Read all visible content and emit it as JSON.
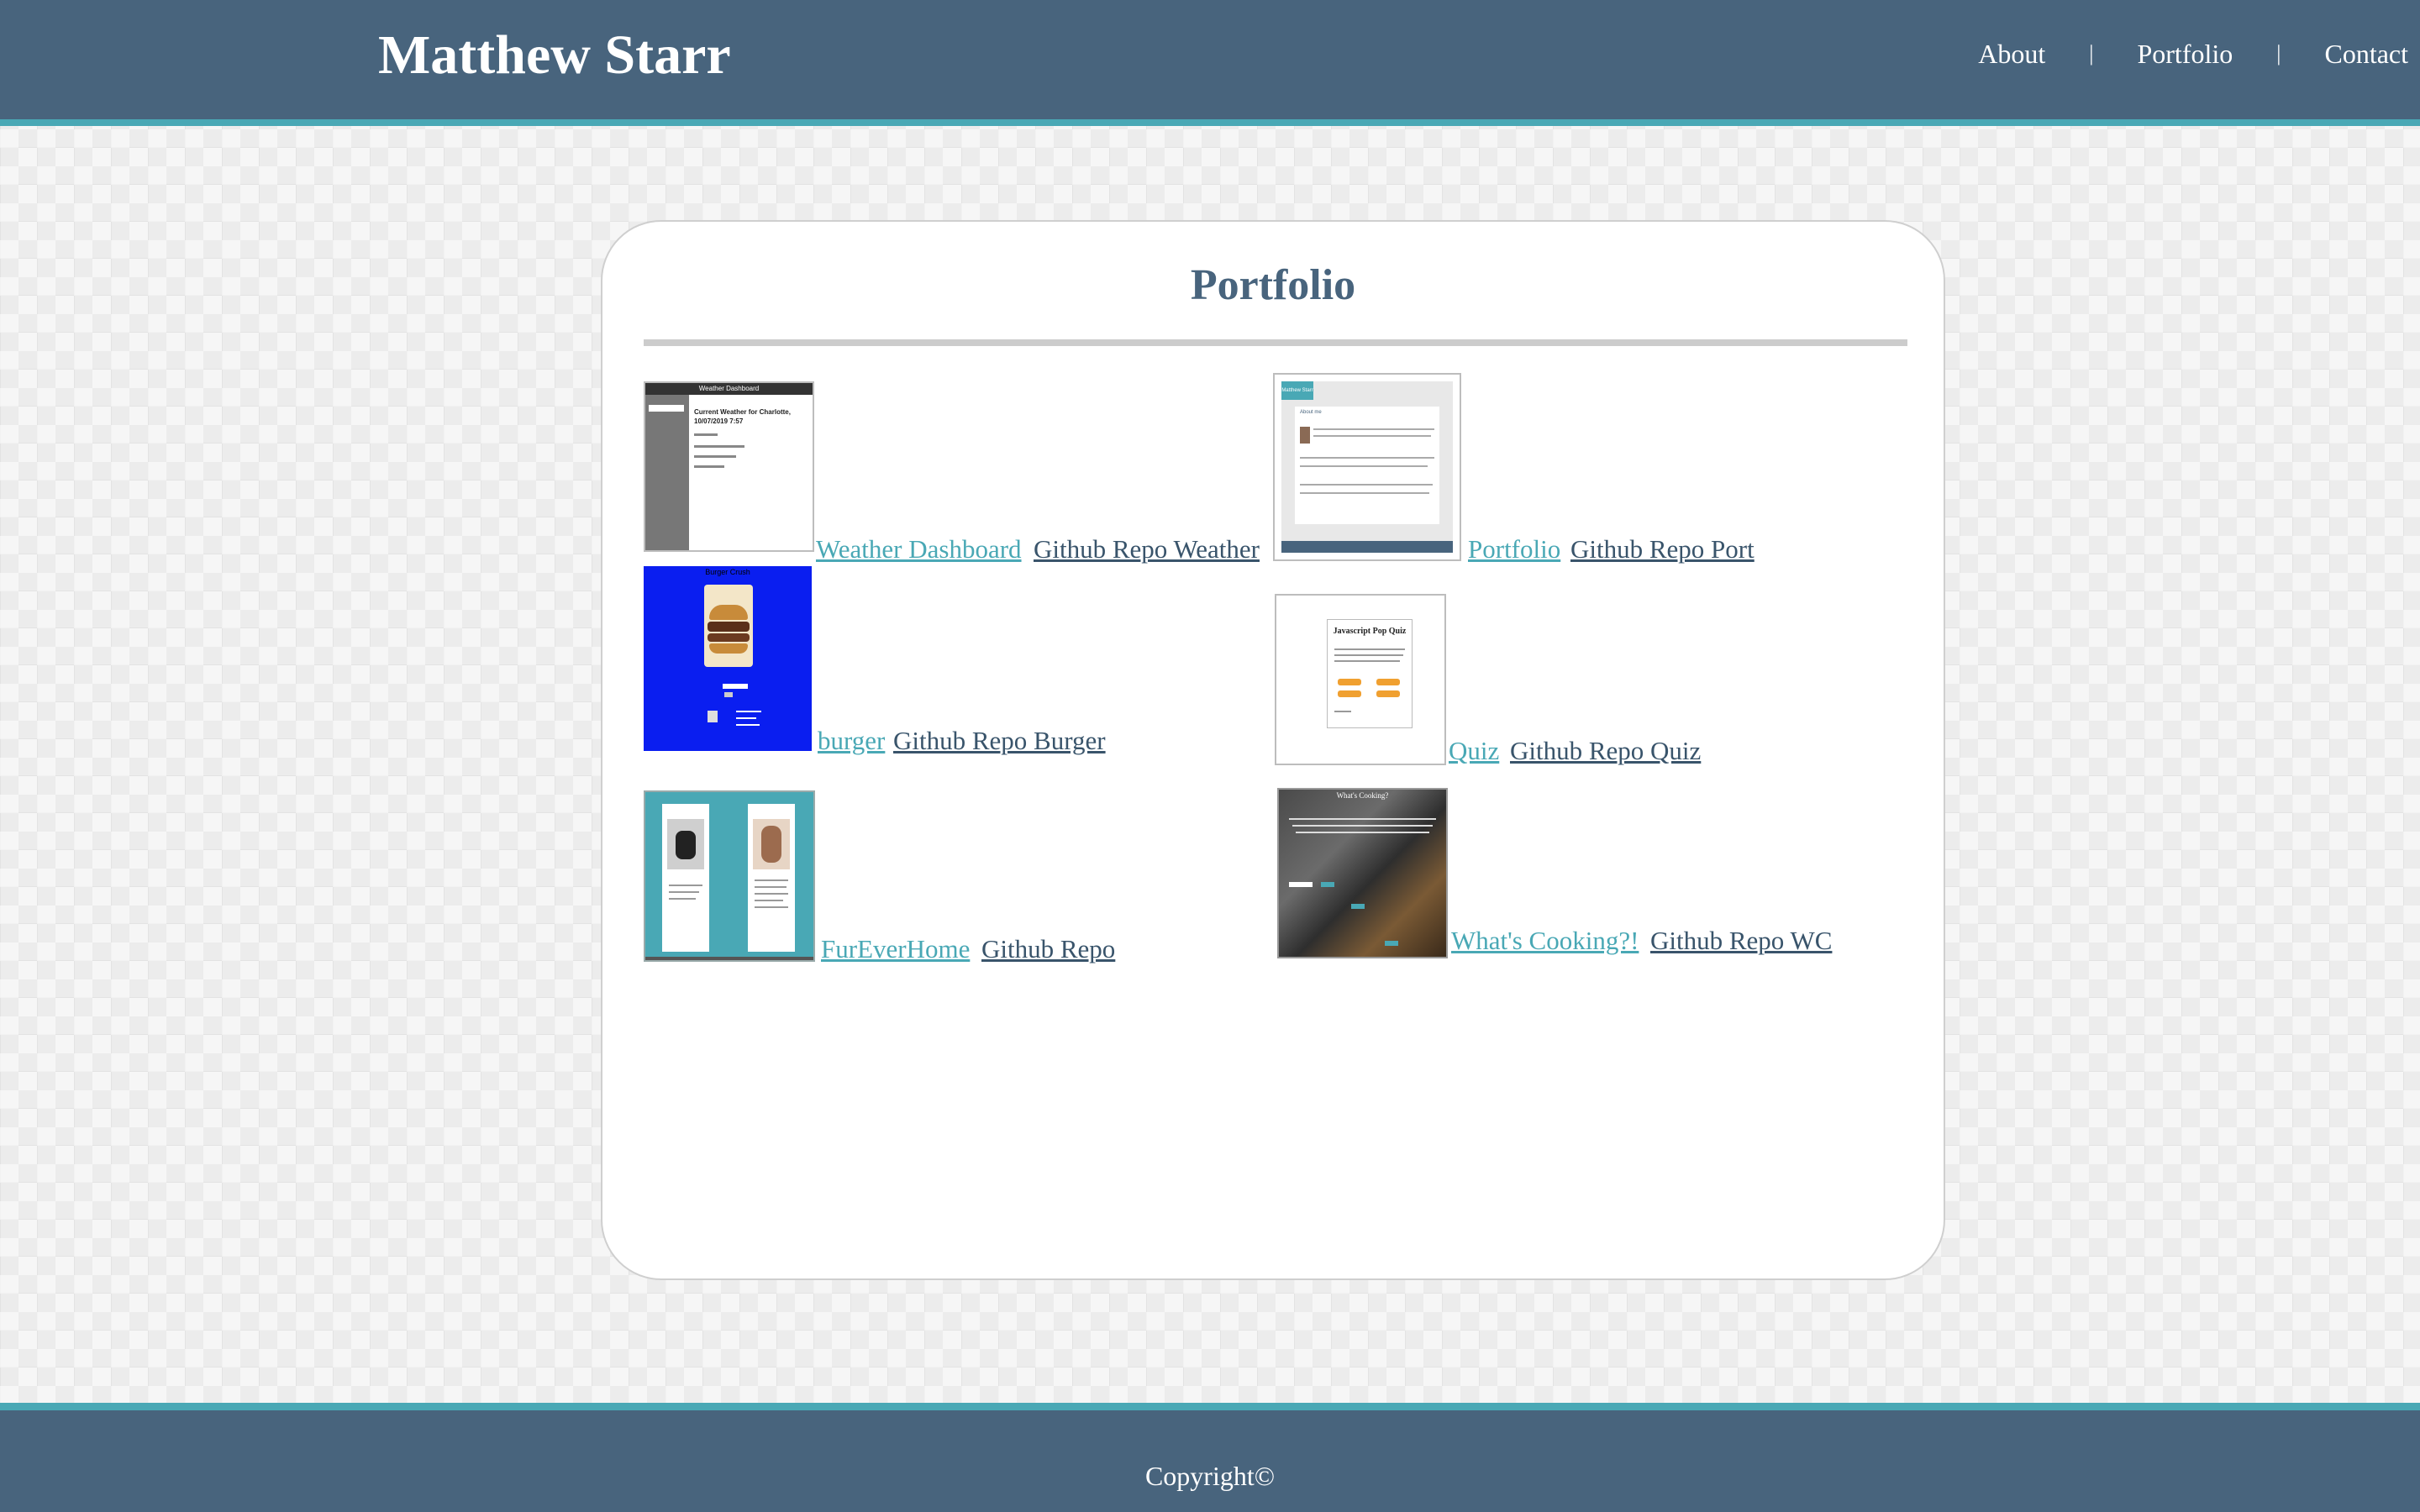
{
  "header": {
    "site_title": "Matthew Starr",
    "nav": [
      "About",
      "Portfolio",
      "Contact"
    ],
    "nav_separator": "|"
  },
  "main": {
    "title": "Portfolio",
    "projects": [
      {
        "demo_label": "Weather Dashboard",
        "repo_label": "Github Repo Weather",
        "thumb": {
          "header": "Weather Dashboard",
          "line1": "Current Weather for Charlotte,",
          "line2": "10/07/2019 7:57"
        }
      },
      {
        "demo_label": "Portfolio",
        "repo_label": "Github Repo Port",
        "thumb": {
          "brand": "Matthew Starr",
          "section": "About me"
        }
      },
      {
        "demo_label": "burger",
        "repo_label": "Github Repo Burger",
        "thumb": {
          "header": "Burger Crush"
        }
      },
      {
        "demo_label": "Quiz",
        "repo_label": "Github Repo Quiz",
        "thumb": {
          "title": "Javascript Pop Quiz"
        }
      },
      {
        "demo_label": "FurEverHome",
        "repo_label": "Github Repo",
        "thumb": {}
      },
      {
        "demo_label": "What's Cooking?!",
        "repo_label": "Github Repo WC",
        "thumb": {
          "title": "What's Cooking?"
        }
      }
    ]
  },
  "footer": {
    "copyright": "Copyright©"
  },
  "colors": {
    "header_bg": "#48647d",
    "accent": "#49a8b5",
    "title": "#48647d",
    "repo_link": "#39546b"
  }
}
